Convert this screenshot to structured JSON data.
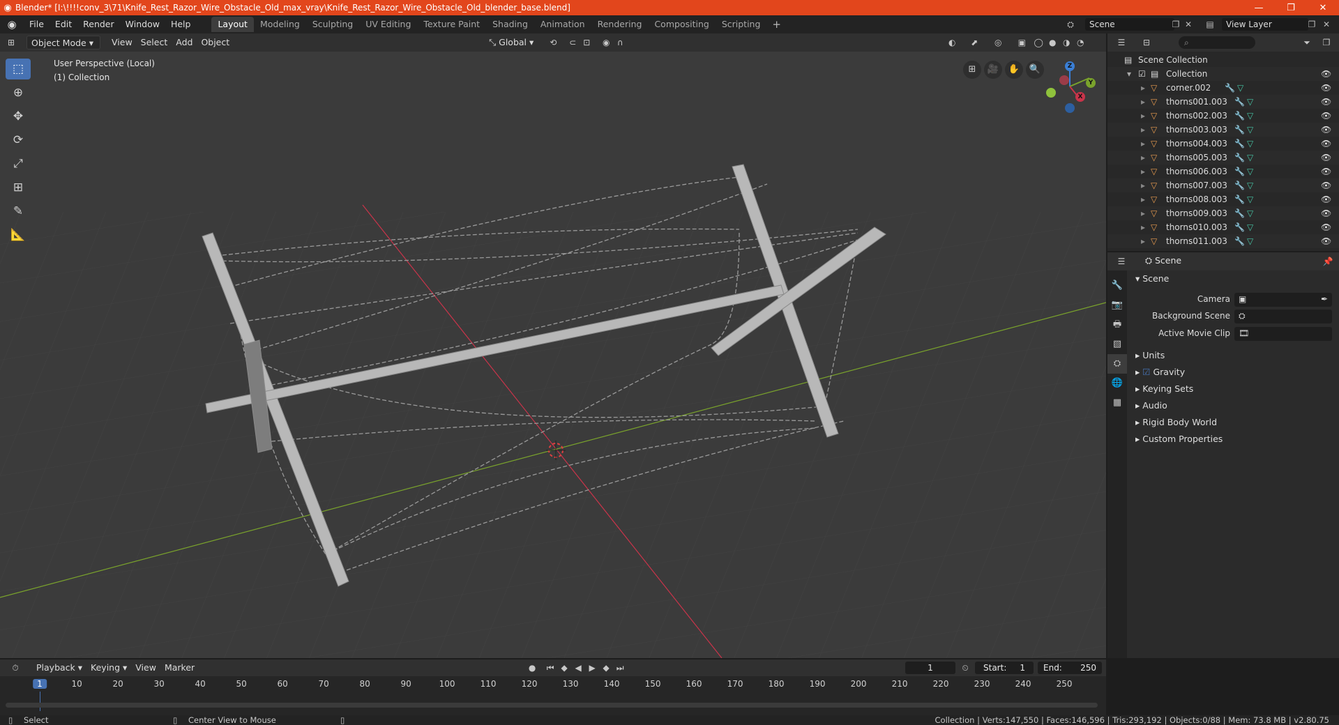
{
  "window": {
    "title": "Blender* [I:\\!!!!conv_3\\71\\Knife_Rest_Razor_Wire_Obstacle_Old_max_vray\\Knife_Rest_Razor_Wire_Obstacle_Old_blender_base.blend]",
    "minimize": "—",
    "maximize": "❐",
    "close": "✕"
  },
  "menu": [
    "File",
    "Edit",
    "Render",
    "Window",
    "Help"
  ],
  "workspaces": [
    "Layout",
    "Modeling",
    "Sculpting",
    "UV Editing",
    "Texture Paint",
    "Shading",
    "Animation",
    "Rendering",
    "Compositing",
    "Scripting"
  ],
  "workspace_add": "+",
  "scene_field": "Scene",
  "view_layer_field": "View Layer",
  "viewport_header": {
    "mode": "Object Mode",
    "menus": [
      "View",
      "Select",
      "Add",
      "Object"
    ],
    "transform": "Global"
  },
  "viewport": {
    "perspective": "User Perspective (Local)",
    "collection": "(1) Collection",
    "gizmo": {
      "x": "X",
      "y": "Y",
      "z": "Z"
    }
  },
  "outliner": {
    "root": "Scene Collection",
    "collection": "Collection",
    "items": [
      "corner.002",
      "thorns001.003",
      "thorns002.003",
      "thorns003.003",
      "thorns004.003",
      "thorns005.003",
      "thorns006.003",
      "thorns007.003",
      "thorns008.003",
      "thorns009.003",
      "thorns010.003",
      "thorns011.003"
    ]
  },
  "properties": {
    "header": "Scene",
    "section": "Scene",
    "fields": [
      "Camera",
      "Background Scene",
      "Active Movie Clip"
    ],
    "panels": [
      "Units",
      "Gravity",
      "Keying Sets",
      "Audio",
      "Rigid Body World",
      "Custom Properties"
    ]
  },
  "timeline": {
    "menus": [
      "Playback",
      "Keying",
      "View",
      "Marker"
    ],
    "current_frame": "1",
    "start_label": "Start:",
    "start": "1",
    "end_label": "End:",
    "end": "250",
    "ticks": [
      "1",
      "10",
      "20",
      "30",
      "40",
      "50",
      "60",
      "70",
      "80",
      "90",
      "100",
      "110",
      "120",
      "130",
      "140",
      "150",
      "160",
      "170",
      "180",
      "190",
      "200",
      "210",
      "220",
      "230",
      "240",
      "250"
    ]
  },
  "statusbar": {
    "left": "Select",
    "middle": "Center View to Mouse",
    "right": "Collection | Verts:147,550 | Faces:146,596 | Tris:293,192 | Objects:0/88 | Mem: 73.8 MB | v2.80.75"
  },
  "colors": {
    "titlebar": "#e2461c",
    "active_tool": "#4772b3",
    "x_axis": "#c9344a",
    "y_axis": "#7aa32c",
    "z_axis": "#3a7fd6"
  }
}
